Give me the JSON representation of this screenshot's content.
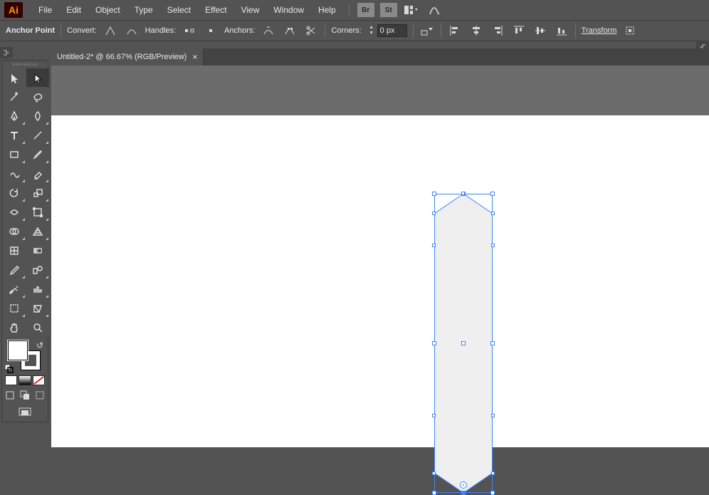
{
  "app": {
    "logo_text": "Ai"
  },
  "menu": {
    "items": [
      "File",
      "Edit",
      "Object",
      "Type",
      "Select",
      "Effect",
      "View",
      "Window",
      "Help"
    ],
    "br_label": "Br",
    "st_label": "St"
  },
  "control": {
    "mode_label": "Anchor Point",
    "convert_label": "Convert:",
    "handles_label": "Handles:",
    "anchors_label": "Anchors:",
    "corners_label": "Corners:",
    "corners_value": "0 px",
    "transform_label": "Transform"
  },
  "document": {
    "tab_title": "Untitled-2* @ 66.67% (RGB/Preview)"
  },
  "tools": {
    "list": [
      "selection-tool",
      "direct-selection-tool",
      "magic-wand-tool",
      "lasso-tool",
      "pen-tool",
      "curvature-tool",
      "type-tool",
      "line-segment-tool",
      "rectangle-tool",
      "paintbrush-tool",
      "shaper-tool",
      "eraser-tool",
      "rotate-tool",
      "scale-tool",
      "width-tool",
      "free-transform-tool",
      "shape-builder-tool",
      "perspective-grid-tool",
      "mesh-tool",
      "gradient-tool",
      "eyedropper-tool",
      "blend-tool",
      "symbol-sprayer-tool",
      "column-graph-tool",
      "artboard-tool",
      "slice-tool",
      "hand-tool",
      "zoom-tool"
    ],
    "selected": "direct-selection-tool"
  },
  "colors": {
    "fill": "#ffffff",
    "stroke": "#000000"
  }
}
